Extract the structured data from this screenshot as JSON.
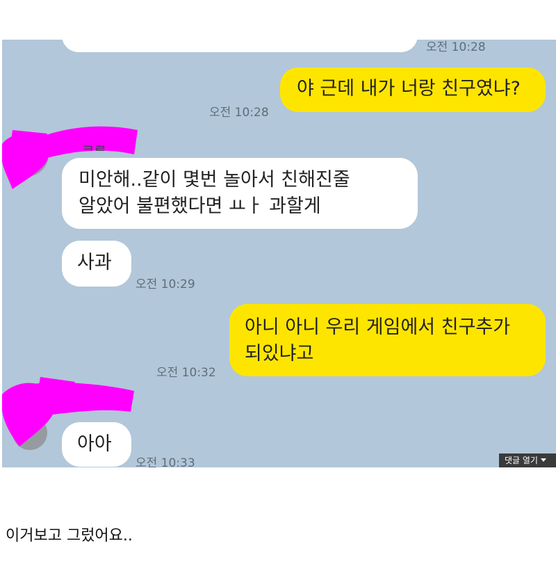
{
  "chat": {
    "top_timestamp": "오전 10:28",
    "messages": [
      {
        "side": "out",
        "text": "야 근데 내가 너랑 친구였냐?",
        "time": "오전 10:28"
      },
      {
        "side": "in",
        "lines": [
          "미안해..같이 몇번 놀아서 친해진줄",
          "알았어 불편했다면 ㅛㅏ 과할게"
        ]
      },
      {
        "side": "in",
        "text": "사과",
        "time": "오전 10:29"
      },
      {
        "side": "out",
        "lines": [
          "아니 아니 우리 게임에서 친구추가",
          "되있냐고"
        ],
        "time": "오전 10:32"
      },
      {
        "side": "in",
        "text": "아아",
        "time": "오전 10:33"
      }
    ],
    "redacted_sender_name_fragment": "ᄏᄅ"
  },
  "overlay": {
    "expand_comments_label": "댓글 열기"
  },
  "caption": {
    "text": "이거보고 그렀어요.."
  },
  "colors": {
    "chat_background": "#b2c7d9",
    "outgoing_bubble": "#fee500",
    "incoming_bubble": "#ffffff",
    "redaction_marker": "#ff00ff"
  }
}
